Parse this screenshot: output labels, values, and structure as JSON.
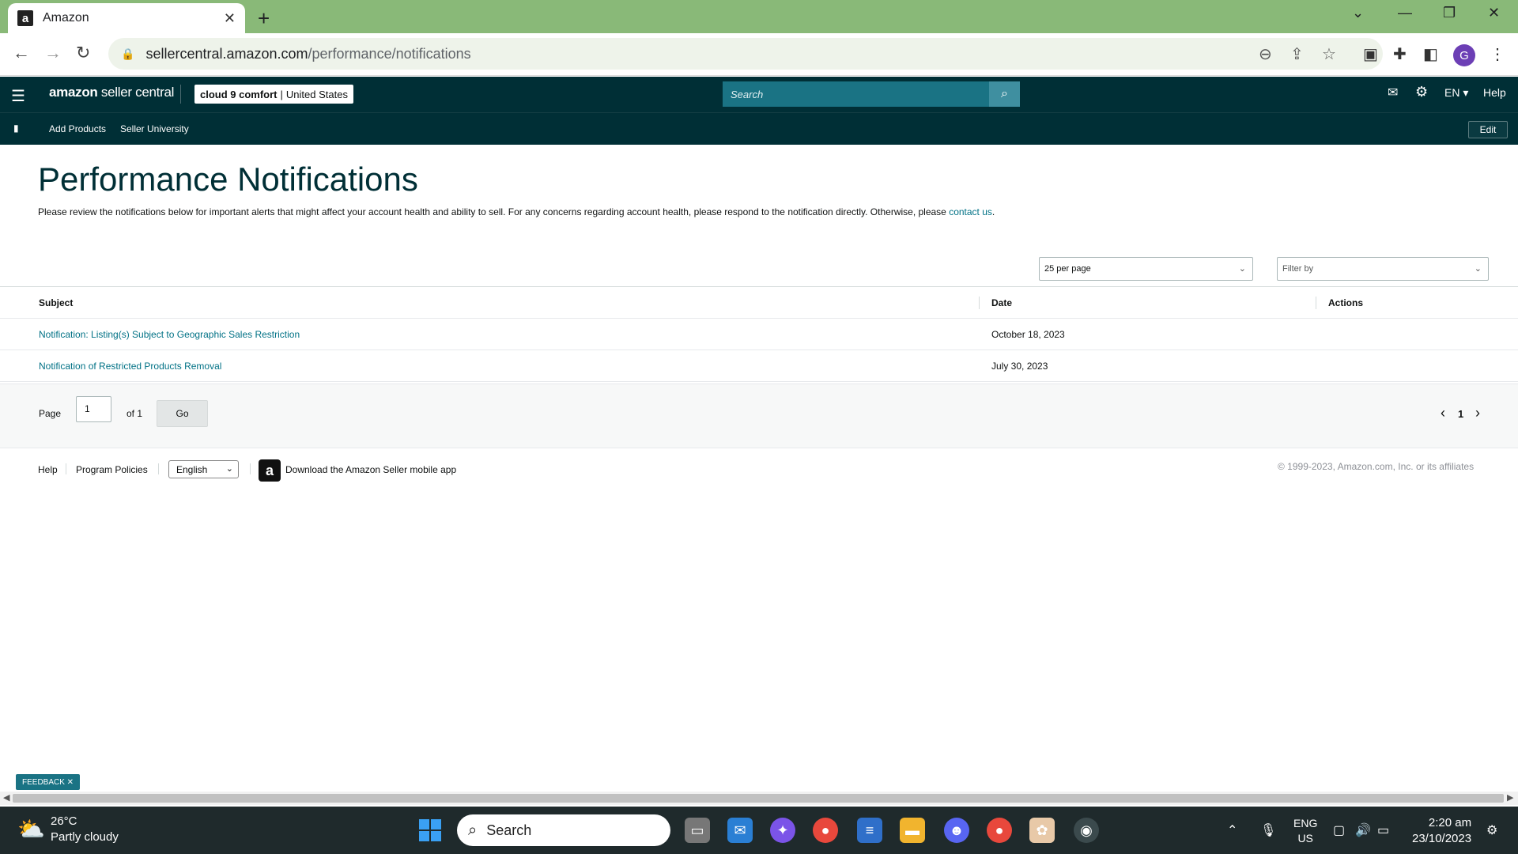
{
  "browser": {
    "tab_title": "Amazon",
    "tab_favicon": "a",
    "new_tab_label": "+",
    "url_host": "sellercentral.amazon.com",
    "url_path": "/performance/notifications",
    "profile_initial": "G"
  },
  "header": {
    "logo_bold": "amazon",
    "logo_thin": " seller central",
    "store_name": "cloud 9 comfort",
    "store_separator": "|",
    "store_region": "United States",
    "search_placeholder": "Search",
    "language": "EN ▾",
    "help": "Help"
  },
  "subnav": {
    "items": [
      "Add Products",
      "Seller University"
    ],
    "edit_label": "Edit"
  },
  "page": {
    "title": "Performance Notifications",
    "description": "Please review the notifications below for important alerts that might affect your account health and ability to sell. For any concerns regarding account health, please respond to the notification directly. Otherwise, please ",
    "contact_link": "contact us",
    "contact_suffix": ".",
    "per_page": "25 per page",
    "filter_placeholder": "Filter by"
  },
  "table": {
    "headers": [
      "Subject",
      "Date",
      "Actions"
    ],
    "rows": [
      {
        "subject": "Notification: Listing(s) Subject to Geographic Sales Restriction",
        "date": "October 18, 2023"
      },
      {
        "subject": "Notification of Restricted Products Removal",
        "date": "July 30, 2023"
      }
    ]
  },
  "pagination": {
    "page_label": "Page",
    "page_value": "1",
    "of_label": "of 1",
    "go_label": "Go",
    "prev": "‹",
    "current": "1",
    "next": "›"
  },
  "footer": {
    "help": "Help",
    "policies": "Program Policies",
    "language": "English",
    "app_text": "Download the Amazon Seller mobile app",
    "copyright": "© 1999-2023, Amazon.com, Inc. or its affiliates"
  },
  "feedback": "FEEDBACK ✕",
  "taskbar": {
    "temperature": "26°C",
    "weather": "Partly cloudy",
    "search": "Search",
    "lang_top": "ENG",
    "lang_bottom": "US",
    "time": "2:20 am",
    "date": "23/10/2023"
  }
}
